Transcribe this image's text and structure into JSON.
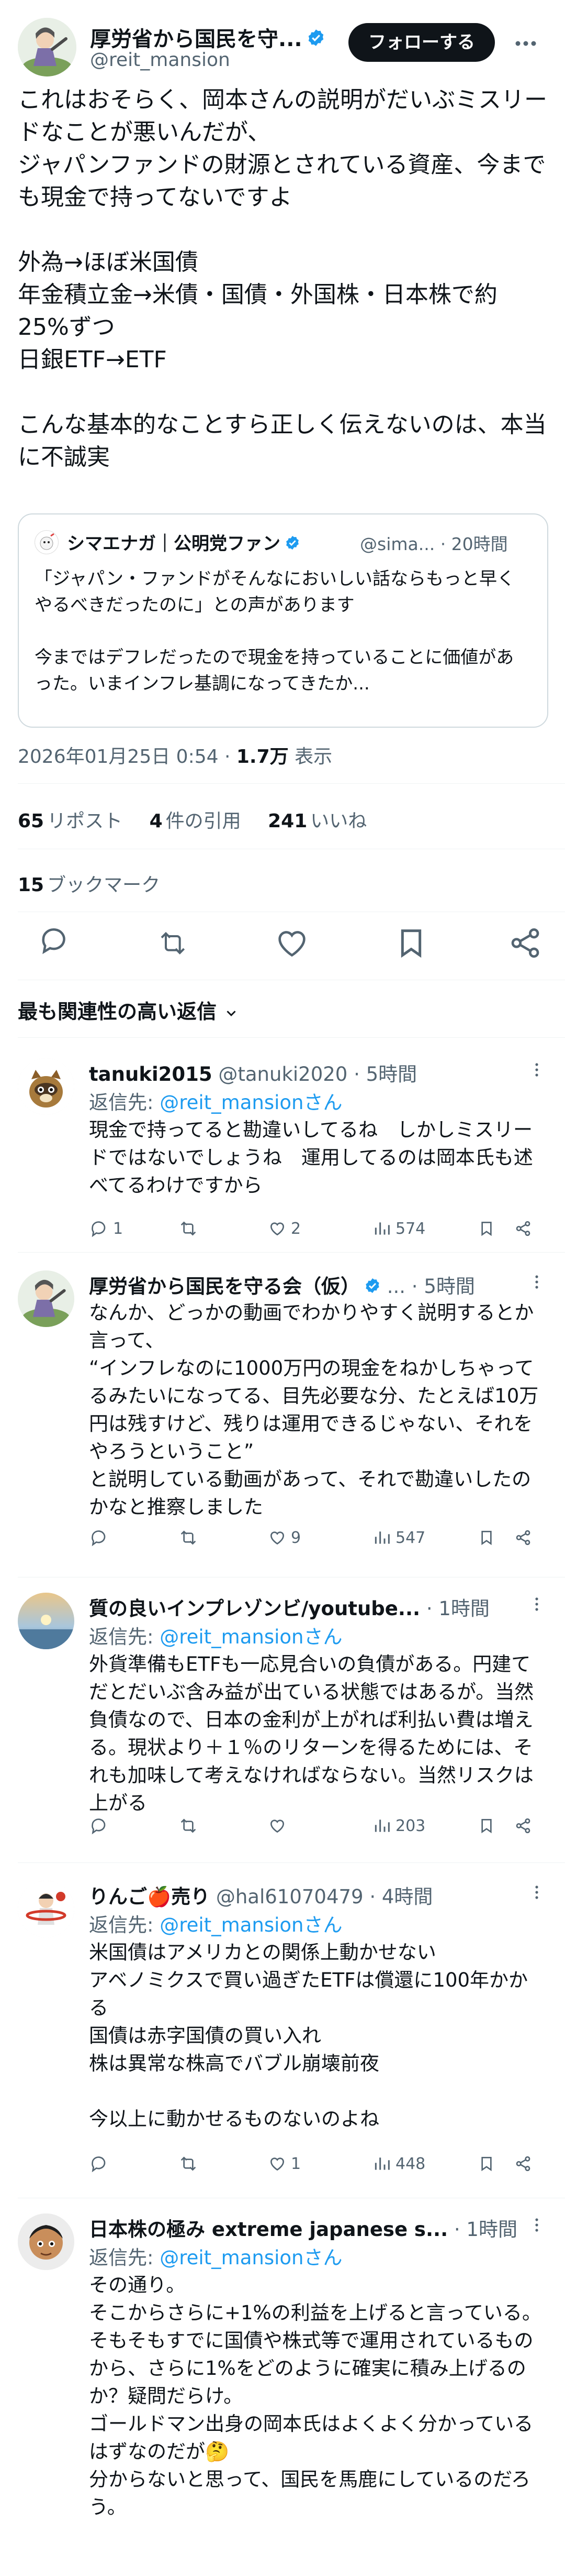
{
  "author": {
    "name": "厚労省から国民を守...",
    "handle": "@reit_mansion",
    "follow_label": "フォローする"
  },
  "tweet": {
    "text": "これはおそらく、岡本さんの説明がだいぶミスリードなことが悪いんだが、\nジャパンファンドの財源とされている資産、今までも現金で持ってないですよ\n\n外為→ほぼ米国債\n年金積立金→米債・国債・外国株・日本株で約25%ずつ\n日銀ETF→ETF\n\nこんな基本的なことすら正しく伝えないのは、本当に不誠実",
    "timestamp": "2026年01月25日 0:54 · ",
    "views_value": "1.7万",
    "views_label": " 表示"
  },
  "quote": {
    "name": "シマエナガ｜公明党ファン",
    "meta": "@sima... · 20時間",
    "text": "「ジャパン・ファンドがそんなにおいしい話ならもっと早くやるべきだったのに」との声があります\n\n今まではデフレだったので現金を持っていることに価値があった。いまインフレ基調になってきたか..."
  },
  "stats": {
    "reposts_value": "65",
    "reposts_label": "リポスト",
    "quotes_value": "4",
    "quotes_label": "件の引用",
    "likes_value": "241",
    "likes_label": "いいね",
    "bookmarks_value": "15",
    "bookmarks_label": "ブックマーク"
  },
  "sort_label": "最も関連性の高い返信",
  "replies": [
    {
      "name": "tanuki2015",
      "handle": "@tanuki2020 · 5時間",
      "reply_prefix": "返信先: ",
      "reply_to": "@reit_mansionさん",
      "text": "現金で持ってると勘違いしてるね　しかしミスリードではないでしょうね　運用してるのは岡本氏も述べてるわけですから",
      "replies": "1",
      "reposts": "",
      "likes": "2",
      "views": "574"
    },
    {
      "name": "厚労省から国民を守る会（仮）",
      "handle": "... · 5時間",
      "text": "なんか、どっかの動画でわかりやすく説明するとか言って、\n“インフレなのに1000万円の現金をねかしちゃってるみたいになってる、目先必要な分、たとえば10万円は残すけど、残りは運用できるじゃない、それをやろうということ”\nと説明している動画があって、それで勘違いしたのかなと推察しました",
      "replies": "",
      "reposts": "",
      "likes": "9",
      "views": "547"
    },
    {
      "name": "質の良いインプレゾンビ/youtube...",
      "handle": " · 1時間",
      "reply_prefix": "返信先: ",
      "reply_to": "@reit_mansionさん",
      "text": "外貨準備もETFも一応見合いの負債がある。円建てだとだいぶ含み益が出ている状態ではあるが。当然負債なので、日本の金利が上がれば利払い費は増える。現状より＋１％のリターンを得るためには、それも加味して考えなければならない。当然リスクは上がる",
      "replies": "",
      "reposts": "",
      "likes": "",
      "views": "203"
    },
    {
      "name": "りんご🍎売り",
      "handle": "@hal61070479 · 4時間",
      "reply_prefix": "返信先: ",
      "reply_to": "@reit_mansionさん",
      "text": "米国債はアメリカとの関係上動かせない\nアベノミクスで買い過ぎたETFは償還に100年かかる\n国債は赤字国債の買い入れ\n株は異常な株高でバブル崩壊前夜\n\n今以上に動かせるものないのよね",
      "replies": "",
      "reposts": "",
      "likes": "1",
      "views": "448"
    },
    {
      "name": "日本株の極み extreme japanese s...",
      "handle": " · 1時間",
      "reply_prefix": "返信先: ",
      "reply_to": "@reit_mansionさん",
      "text": "その通り。\nそこからさらに+1%の利益を上げると言っている。\nそもそもすでに国債や株式等で運用されているものから、さらに1%をどのように確実に積み上げるのか？疑問だらけ。\nゴールドマン出身の岡本氏はよくよく分かっているはずなのだが🤔\n分からないと思って、国民を馬鹿にしているのだろう。",
      "replies": "",
      "reposts": "",
      "likes": "",
      "views": ""
    }
  ]
}
